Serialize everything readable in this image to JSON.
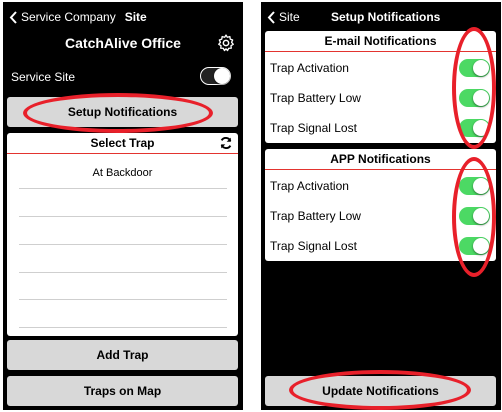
{
  "left": {
    "back_label": "Service Company",
    "back_context": "Site",
    "title": "CatchAlive Office",
    "service_site_label": "Service Site",
    "service_site_enabled": false,
    "setup_button": "Setup Notifications",
    "select_trap_header": "Select Trap",
    "traps": [
      "At Backdoor"
    ],
    "add_trap_button": "Add Trap",
    "map_button": "Traps on Map"
  },
  "right": {
    "back_label": "Site",
    "title": "Setup Notifications",
    "email_section": {
      "header": "E-mail Notifications",
      "items": [
        {
          "label": "Trap Activation",
          "enabled": true
        },
        {
          "label": "Trap Battery Low",
          "enabled": true
        },
        {
          "label": "Trap Signal Lost",
          "enabled": true
        }
      ]
    },
    "app_section": {
      "header": "APP Notifications",
      "items": [
        {
          "label": "Trap Activation",
          "enabled": true
        },
        {
          "label": "Trap Battery Low",
          "enabled": true
        },
        {
          "label": "Trap Signal Lost",
          "enabled": true
        }
      ]
    },
    "update_button": "Update Notifications"
  },
  "colors": {
    "toggle_on": "#4cd964",
    "highlight_ring": "#e8202a",
    "divider": "#e3342f"
  }
}
